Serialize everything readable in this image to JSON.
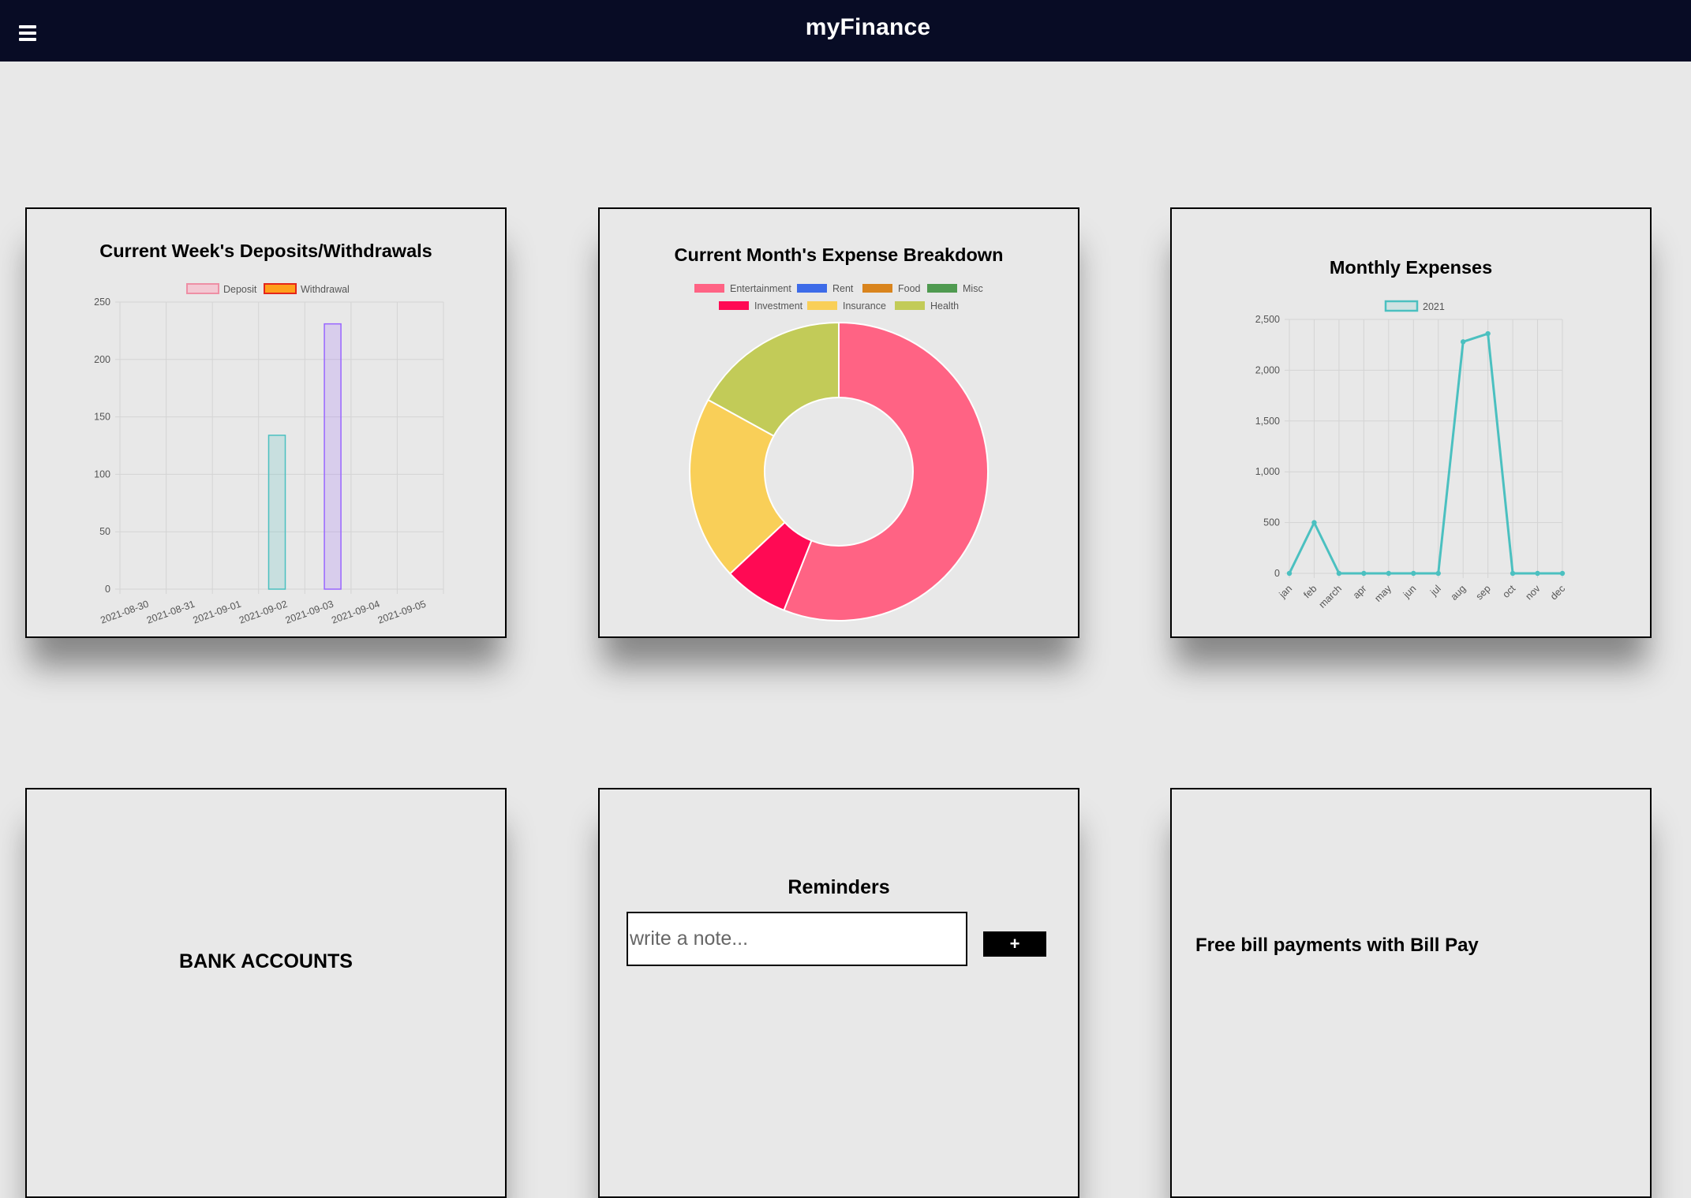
{
  "header": {
    "title": "myFinance",
    "menu_icon": "hamburger-menu-icon"
  },
  "colors": {
    "header_bg": "#080c25",
    "deposit": "#4bc0c0",
    "withdrawal": "#9966ff",
    "line_2021": "#4bc0c0"
  },
  "cards": {
    "weekly": {
      "title": "Current Week's Deposits/Withdrawals"
    },
    "breakdown": {
      "title": "Current Month's Expense Breakdown"
    },
    "monthly": {
      "title": "Monthly Expenses"
    },
    "bank": {
      "title": "BANK ACCOUNTS"
    },
    "reminders": {
      "title": "Reminders",
      "placeholder": "write a note...",
      "add_label": "+"
    },
    "billpay": {
      "title": "Free bill payments with Bill Pay"
    }
  },
  "chart_data": [
    {
      "type": "bar",
      "title": "Current Week's Deposits/Withdrawals",
      "categories": [
        "2021-08-30",
        "2021-08-31",
        "2021-09-01",
        "2021-09-02",
        "2021-09-03",
        "2021-09-04",
        "2021-09-05"
      ],
      "series": [
        {
          "name": "Deposit",
          "values": [
            0,
            0,
            0,
            134,
            0,
            0,
            0
          ],
          "color": "#4bc0c0"
        },
        {
          "name": "Withdrawal",
          "values": [
            0,
            0,
            0,
            0,
            231,
            0,
            0
          ],
          "color": "#9966ff"
        }
      ],
      "legend": [
        {
          "name": "Deposit",
          "fill": "#f3c8d3",
          "stroke": "#ee8fa5"
        },
        {
          "name": "Withdrawal",
          "fill": "#ff9f1c",
          "stroke": "#e5261a"
        }
      ],
      "ylim": [
        0,
        250
      ],
      "yticks": [
        0,
        50,
        100,
        150,
        200,
        250
      ],
      "grid": true,
      "legend_position": "top"
    },
    {
      "type": "pie",
      "title": "Current Month's Expense Breakdown",
      "labels": [
        "Entertainment",
        "Rent",
        "Food",
        "Misc",
        "Investment",
        "Insurance",
        "Health"
      ],
      "values": [
        56,
        0,
        0,
        0,
        7,
        20,
        17
      ],
      "colors": [
        "#ff6384",
        "#3d6be8",
        "#d9841d",
        "#4f9a50",
        "#ff0a54",
        "#f9cf58",
        "#c2cb58"
      ],
      "legend_position": "top"
    },
    {
      "type": "line",
      "title": "Monthly Expenses",
      "categories": [
        "jan",
        "feb",
        "march",
        "apr",
        "may",
        "jun",
        "jul",
        "aug",
        "sep",
        "oct",
        "nov",
        "dec"
      ],
      "series": [
        {
          "name": "2021",
          "values": [
            0,
            500,
            0,
            0,
            0,
            0,
            0,
            2280,
            2360,
            0,
            0,
            0
          ],
          "color": "#4bc0c0"
        }
      ],
      "ylim": [
        0,
        2500
      ],
      "yticks": [
        "0",
        "500",
        "1,000",
        "1,500",
        "2,000",
        "2,500"
      ],
      "grid": true,
      "legend_position": "top"
    }
  ]
}
